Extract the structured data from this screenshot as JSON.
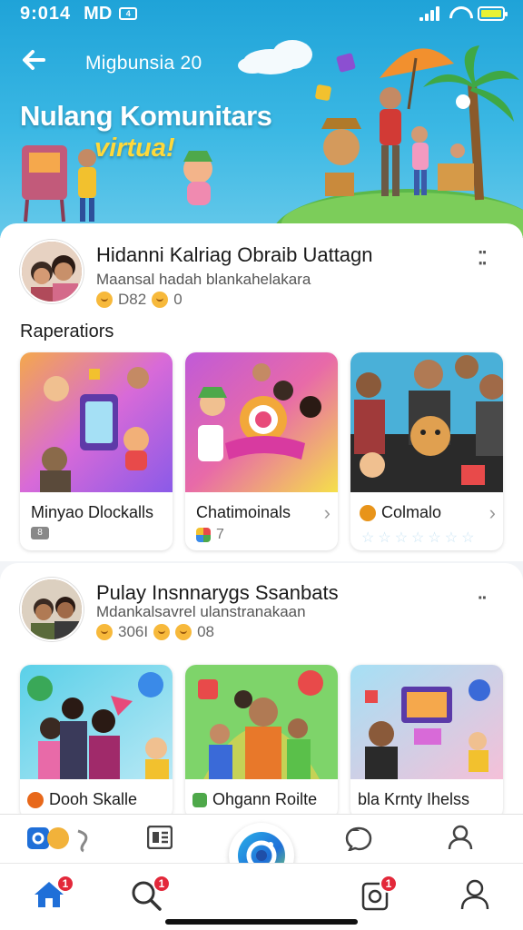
{
  "status_bar": {
    "time": "9:014",
    "carrier": "MD",
    "sim_label": "4"
  },
  "header": {
    "back_icon": "arrow-left-icon",
    "title": "Migbunsia 20"
  },
  "hero": {
    "line1": "Nulang Komunitars",
    "line2": "virtua!"
  },
  "post1": {
    "title": "Hidanni Kalriag Obraib Uattagn",
    "subtitle": "Maansal hadah blankahelakara",
    "stat1": "D82",
    "stat2": "0",
    "section_label": "Raperatiors",
    "tiles": [
      {
        "label": "Minyao Dlockalls",
        "meta": "8"
      },
      {
        "label": "Chatimoinals",
        "meta": "7"
      },
      {
        "label": "Colmalo",
        "meta": "☆☆☆☆☆☆☆"
      }
    ]
  },
  "post2": {
    "title": "Pulay Insnnarygs Ssanbats",
    "subtitle": "Mdankalsavrel ulanstranakaan",
    "stat1": "306I",
    "stat2": "08",
    "tiles": [
      {
        "label": "Dooh Skalle"
      },
      {
        "label": "Ohgann Roilte"
      },
      {
        "label": "bla Krnty Ihelss"
      }
    ]
  },
  "bottom_nav": {
    "home_badge": "1",
    "search_badge": "1",
    "notify_badge": "1"
  },
  "colors": {
    "accent": "#1fa3d8",
    "badge": "#e3283a",
    "highlight": "#ffd93a"
  }
}
